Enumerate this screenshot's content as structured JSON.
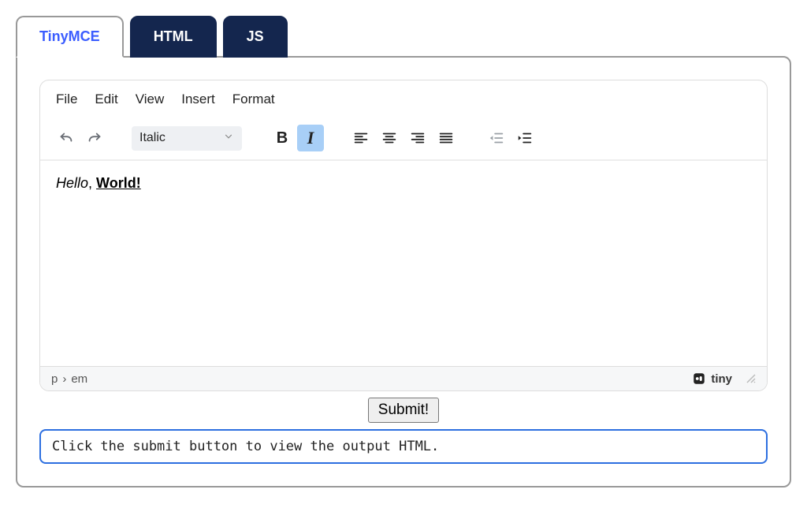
{
  "tabs": {
    "active": "TinyMCE",
    "html": "HTML",
    "js": "JS"
  },
  "menu": {
    "file": "File",
    "edit": "Edit",
    "view": "View",
    "insert": "Insert",
    "format": "Format"
  },
  "toolbar": {
    "fontstyle": "Italic",
    "bold_glyph": "B",
    "italic_glyph": "I"
  },
  "content": {
    "hello": "Hello",
    "comma": ", ",
    "world": "World!"
  },
  "status": {
    "path_p": "p",
    "path_sep": "›",
    "path_em": "em",
    "brand": "tiny"
  },
  "submit": {
    "label": "Submit!"
  },
  "output": {
    "text": "Click the submit button to view the output HTML."
  }
}
